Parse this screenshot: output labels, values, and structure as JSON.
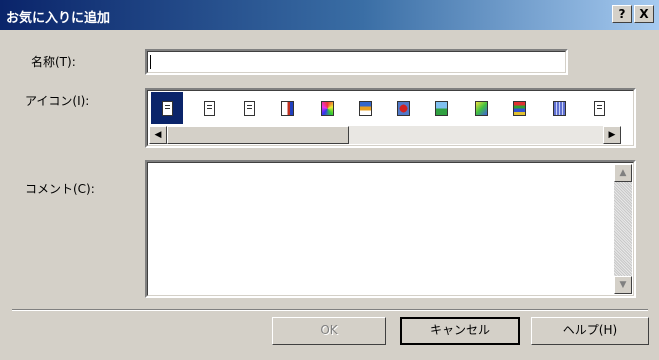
{
  "dialog": {
    "title": "お気に入りに追加",
    "help_button": "?",
    "close_button": "X"
  },
  "name_field": {
    "label": "名称(T):",
    "value": ""
  },
  "icon_field": {
    "label": "アイコン(I):",
    "icons": [
      {
        "name": "document-icon",
        "selected": true
      },
      {
        "name": "notes-icon"
      },
      {
        "name": "text-document-icon"
      },
      {
        "name": "report-icon"
      },
      {
        "name": "color-wheel-icon"
      },
      {
        "name": "colored-document-icon"
      },
      {
        "name": "red-image-icon"
      },
      {
        "name": "landscape-image-icon"
      },
      {
        "name": "gradient-image-icon"
      },
      {
        "name": "striped-document-icon"
      },
      {
        "name": "blue-document-icon"
      },
      {
        "name": "gray-document-icon"
      }
    ],
    "scroll_fraction": 0.4
  },
  "comment_field": {
    "label": "コメント(C):",
    "value": ""
  },
  "buttons": {
    "ok": "OK",
    "cancel": "キャンセル",
    "help": "ヘルプ(H)"
  }
}
